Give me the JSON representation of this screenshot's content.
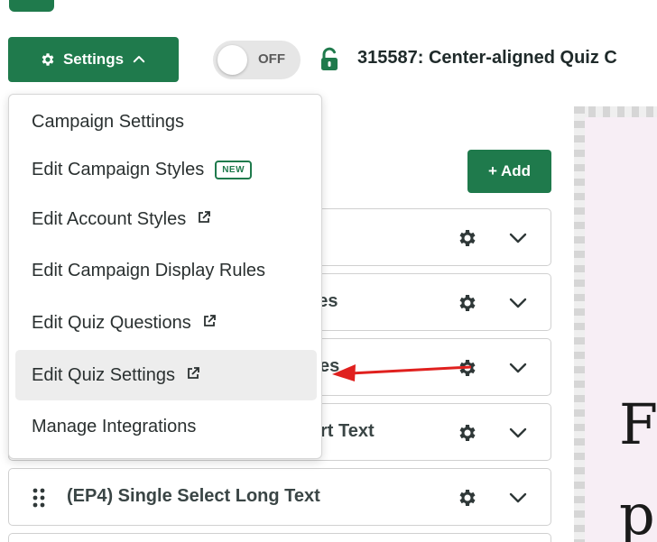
{
  "header": {
    "settings_label": "Settings",
    "toggle_label": "OFF",
    "campaign_title": "315587: Center-aligned Quiz C"
  },
  "builder": {
    "add_label": "+ Add",
    "rows": [
      {
        "label": ""
      },
      {
        "label": "ges"
      },
      {
        "label": "es"
      },
      {
        "label": "rt Text"
      },
      {
        "label": "(EP4) Single Select Long Text"
      }
    ]
  },
  "settings_menu": {
    "items": [
      {
        "label": "Campaign Settings"
      },
      {
        "label": "Edit Campaign Styles",
        "badge": "NEW"
      },
      {
        "label": "Edit Account Styles",
        "external": true
      },
      {
        "label": "Edit Campaign Display Rules"
      },
      {
        "label": "Edit Quiz Questions",
        "external": true
      },
      {
        "label": "Edit Quiz Settings",
        "external": true,
        "highlighted": true
      },
      {
        "label": "Manage Integrations"
      }
    ]
  },
  "preview": {
    "line1": "F",
    "line2": "p"
  },
  "colors": {
    "brand_green": "#1f7a4c",
    "annotation_red": "#e0201e",
    "preview_bg": "#f7eef5"
  },
  "icons": [
    "gear-icon",
    "chevron-up-icon",
    "lock-open-icon",
    "chevron-down-icon",
    "drag-handle-icon",
    "external-link-icon"
  ]
}
